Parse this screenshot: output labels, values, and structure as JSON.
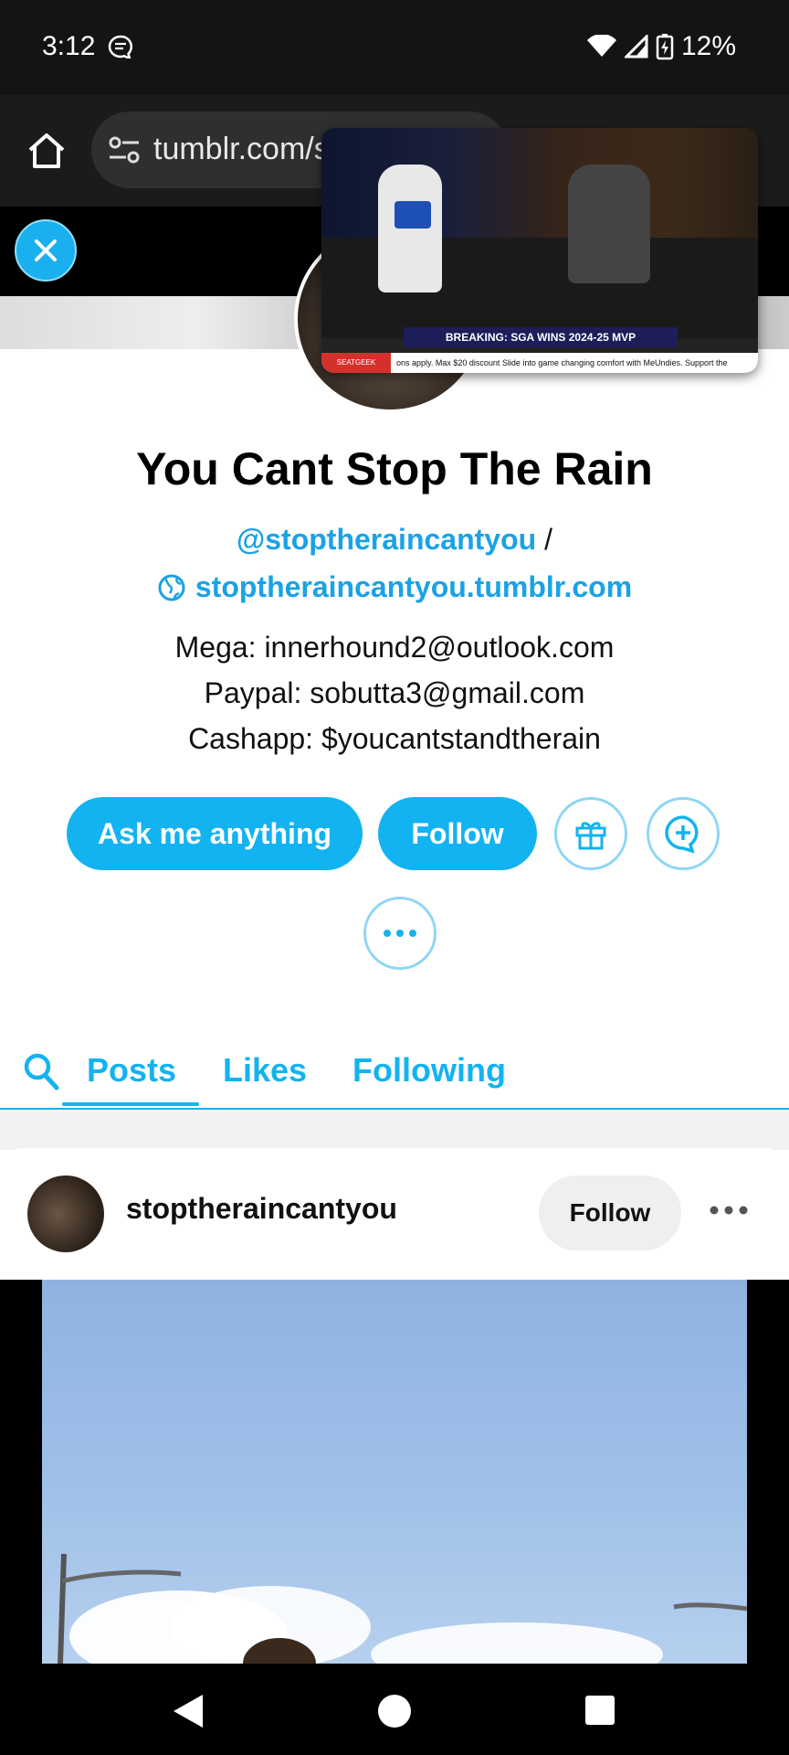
{
  "status_bar": {
    "time": "3:12",
    "battery": "12%"
  },
  "browser": {
    "url": "tumblr.com/s"
  },
  "pip": {
    "banner": "BREAKING: SGA WINS 2024-25 MVP",
    "ticker_logo": "SEATGEEK",
    "ticker_text": "ons apply. Max $20 discount        Slide into game changing comfort with MeUndies. Support the"
  },
  "profile": {
    "title": "You Cant Stop The Rain",
    "handle": "@stoptheraincantyou",
    "separator": "/",
    "site": "stoptheraincantyou.tumblr.com",
    "desc_lines": [
      "Mega: innerhound2@outlook.com",
      "Paypal: sobutta3@gmail.com",
      "Cashapp: $youcantstandtherain"
    ],
    "ask_label": "Ask me anything",
    "follow_label": "Follow"
  },
  "tabs": [
    "Posts",
    "Likes",
    "Following"
  ],
  "post": {
    "username": "stoptheraincantyou",
    "follow_label": "Follow"
  },
  "colors": {
    "accent": "#12b3f0",
    "link": "#1aa2e6"
  }
}
